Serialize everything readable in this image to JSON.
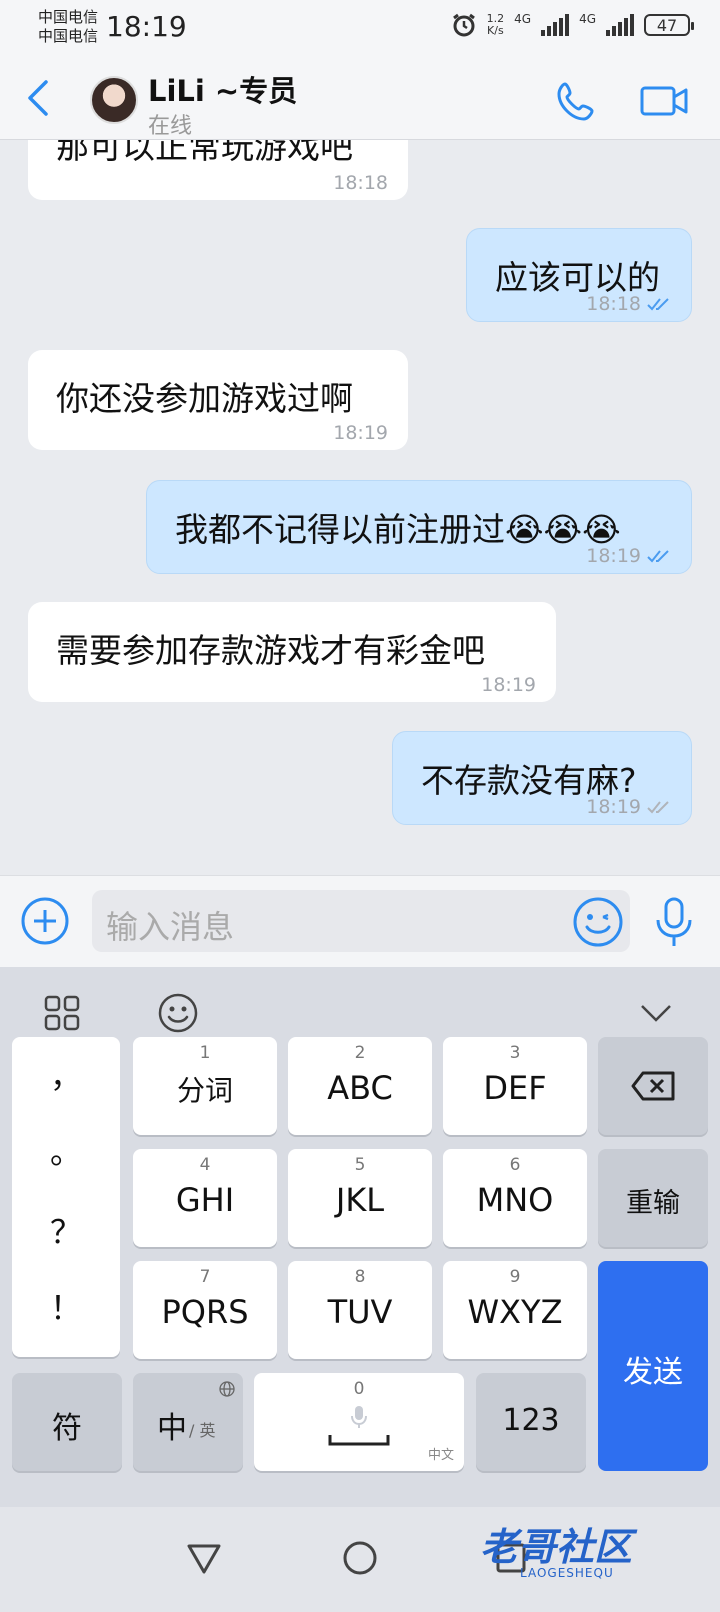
{
  "statusbar": {
    "carrier1": "中国电信",
    "carrier2": "中国电信",
    "time": "18:19",
    "speed_val": "1.2",
    "speed_unit": "K/s",
    "net1": "4G",
    "net2": "4G",
    "battery": "47"
  },
  "header": {
    "name": "LiLi ~专员",
    "status": "在线"
  },
  "messages": [
    {
      "dir": "in",
      "text": "那可以正常玩游戏吧",
      "time": "18:18"
    },
    {
      "dir": "out",
      "text": "应该可以的",
      "time": "18:18"
    },
    {
      "dir": "in",
      "text": "你还没参加游戏过啊",
      "time": "18:19"
    },
    {
      "dir": "out",
      "text": "我都不记得以前注册过😭😭😭",
      "time": "18:19"
    },
    {
      "dir": "in",
      "text": "需要参加存款游戏才有彩金吧",
      "time": "18:19"
    },
    {
      "dir": "out",
      "text": "不存款没有麻?",
      "time": "18:19"
    }
  ],
  "input": {
    "placeholder": "输入消息"
  },
  "keyboard": {
    "punct": [
      "，",
      "。",
      "？",
      "！"
    ],
    "keys": [
      {
        "num": "1",
        "label": "分词"
      },
      {
        "num": "2",
        "label": "ABC"
      },
      {
        "num": "3",
        "label": "DEF"
      },
      {
        "num": "4",
        "label": "GHI"
      },
      {
        "num": "5",
        "label": "JKL"
      },
      {
        "num": "6",
        "label": "MNO"
      },
      {
        "num": "7",
        "label": "PQRS"
      },
      {
        "num": "8",
        "label": "TUV"
      },
      {
        "num": "9",
        "label": "WXYZ"
      }
    ],
    "reinput": "重输",
    "send": "发送",
    "symbols": "符",
    "lang_main": "中",
    "lang_sub": "/ 英",
    "space_num": "0",
    "space_sub": "中文",
    "numbers": "123"
  },
  "watermark": {
    "title": "老哥社区",
    "sub": "LAOGESHEQU"
  }
}
